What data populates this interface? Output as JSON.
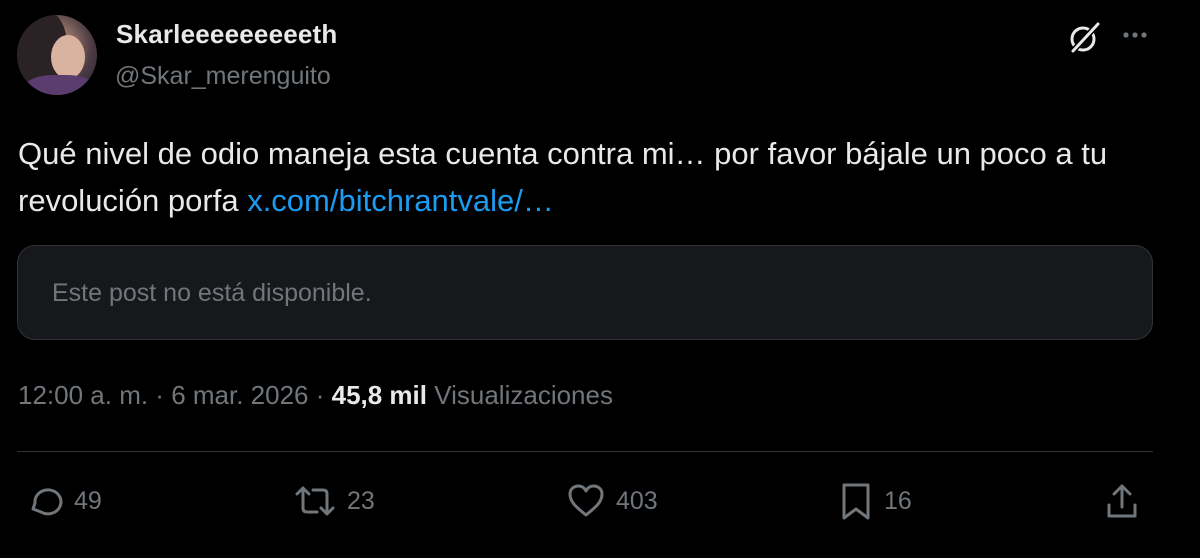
{
  "author": {
    "display_name": "Skarleeeeeeeeeth",
    "handle": "@Skar_merenguito"
  },
  "header": {
    "grok_icon": "grok-icon",
    "more_icon": "more-icon"
  },
  "tweet": {
    "text": "Qué nivel de odio maneja esta cuenta contra mi… por favor bájale un poco a tu revolución porfa ",
    "link": "x.com/bitchrantvale/…",
    "link_color": "#1d9bf0"
  },
  "quoted_post": {
    "message": "Este post no está disponible."
  },
  "meta": {
    "time": "12:00 a. m.",
    "separator1": " · ",
    "date": "6 mar. 2026",
    "separator2": " · ",
    "views_count": "45,8 mil",
    "views_label": " Visualizaciones"
  },
  "actions": {
    "replies": "49",
    "reposts": "23",
    "likes": "403",
    "bookmarks": "16"
  },
  "colors": {
    "background": "#000000",
    "text": "#e7e9ea",
    "secondary": "#71767b",
    "accent": "#1d9bf0",
    "border": "#2f3336"
  }
}
